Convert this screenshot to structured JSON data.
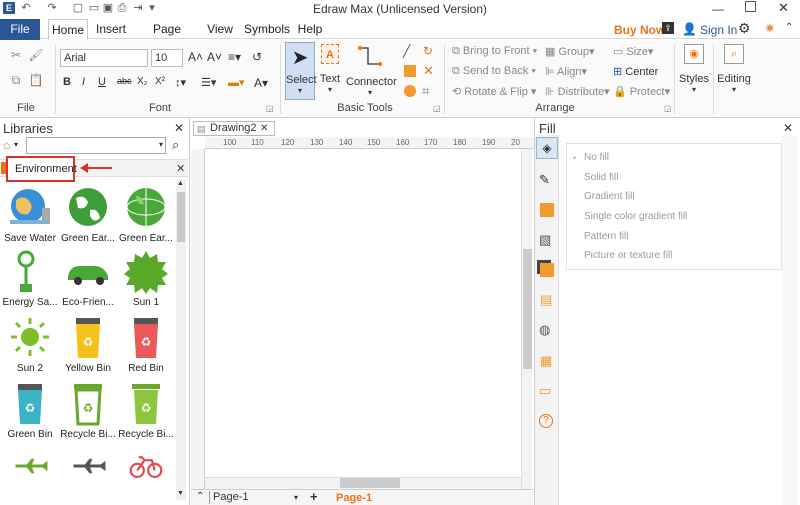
{
  "window_title": "Edraw Max (Unlicensed Version)",
  "menu": {
    "file": "File",
    "tabs": [
      "Home",
      "Insert",
      "Page Layout",
      "View",
      "Symbols",
      "Help"
    ],
    "buy_now": "Buy Now",
    "sign_in": "Sign In"
  },
  "ribbon": {
    "font_name": "Arial",
    "font_size": "10",
    "groups": {
      "file": "File",
      "font": "Font",
      "basic_tools": "Basic Tools",
      "arrange": "Arrange"
    },
    "select": "Select",
    "text": "Text",
    "connector": "Connector",
    "bring_to_front": "Bring to Front",
    "send_to_back": "Send to Back",
    "rotate_flip": "Rotate & Flip",
    "group": "Group",
    "align": "Align",
    "distribute": "Distribute",
    "size": "Size",
    "center": "Center",
    "protect": "Protect",
    "styles": "Styles",
    "editing": "Editing"
  },
  "libraries": {
    "title": "Libraries",
    "category": "Environment",
    "shapes": [
      {
        "label": "Save Water",
        "icon": "globe-water-icon"
      },
      {
        "label": "Green Ear...",
        "icon": "green-earth-icon"
      },
      {
        "label": "Green Ear...",
        "icon": "green-earth-alt-icon"
      },
      {
        "label": "Energy Sa...",
        "icon": "energy-plug-icon"
      },
      {
        "label": "Eco-Frien...",
        "icon": "eco-car-icon"
      },
      {
        "label": "Sun 1",
        "icon": "sun-badge-icon"
      },
      {
        "label": "Sun 2",
        "icon": "sun-icon"
      },
      {
        "label": "Yellow Bin",
        "icon": "yellow-bin-icon"
      },
      {
        "label": "Red Bin",
        "icon": "red-bin-icon"
      },
      {
        "label": "Green Bin",
        "icon": "green-bin-icon"
      },
      {
        "label": "Recycle Bi...",
        "icon": "recycle-bin-icon"
      },
      {
        "label": "Recycle Bi...",
        "icon": "recycle-bin-alt-icon"
      },
      {
        "label": "",
        "icon": "airplane-icon"
      },
      {
        "label": "",
        "icon": "airplane-alt-icon"
      },
      {
        "label": "",
        "icon": "bicycle-icon"
      }
    ]
  },
  "document": {
    "tab": "Drawing2",
    "ruler_ticks": [
      "100",
      "110",
      "120",
      "130",
      "140",
      "150",
      "160",
      "170",
      "180",
      "190",
      "20"
    ],
    "page_select": "Page-1",
    "active_page": "Page-1"
  },
  "fill_panel": {
    "title": "Fill",
    "options": [
      "No fill",
      "Solid fill",
      "Gradient fill",
      "Single color gradient fill",
      "Pattern fill",
      "Picture or texture fill"
    ]
  },
  "colors": {
    "accent": "#2b5797",
    "buy_now": "#e8731a",
    "highlight_red": "#d9342b",
    "page_tab": "#e8731a"
  }
}
